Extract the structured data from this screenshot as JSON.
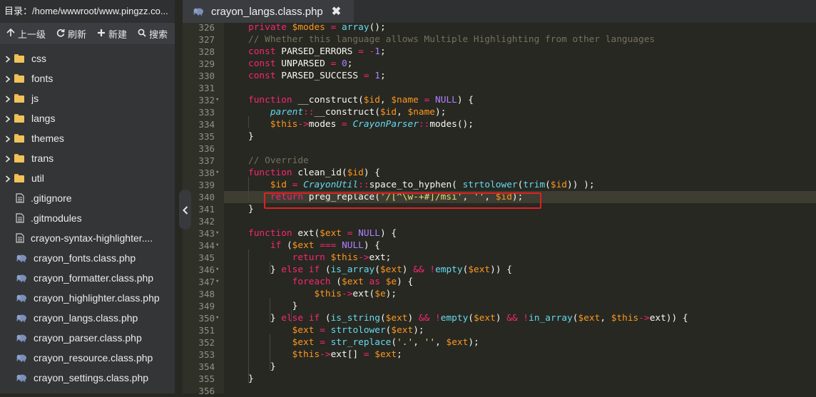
{
  "sidebar": {
    "path_label": "目录：/home/wwwroot/www.pingzz.co...",
    "toolbar": {
      "up": "上一级",
      "refresh": "刷新",
      "new": "新建",
      "search": "搜索"
    },
    "folders": [
      "css",
      "fonts",
      "js",
      "langs",
      "themes",
      "trans",
      "util"
    ],
    "files": [
      {
        "name": ".gitignore",
        "type": "file"
      },
      {
        "name": ".gitmodules",
        "type": "file"
      },
      {
        "name": "crayon-syntax-highlighter....",
        "type": "file"
      },
      {
        "name": "crayon_fonts.class.php",
        "type": "php"
      },
      {
        "name": "crayon_formatter.class.php",
        "type": "php"
      },
      {
        "name": "crayon_highlighter.class.php",
        "type": "php"
      },
      {
        "name": "crayon_langs.class.php",
        "type": "php"
      },
      {
        "name": "crayon_parser.class.php",
        "type": "php"
      },
      {
        "name": "crayon_resource.class.php",
        "type": "php"
      },
      {
        "name": "crayon_settings.class.php",
        "type": "php"
      }
    ]
  },
  "tab": {
    "title": "crayon_langs.class.php",
    "close": "✖"
  },
  "editor": {
    "active_line": 340,
    "highlighted_line": 340,
    "lines": [
      {
        "n": "326",
        "fold": false,
        "t": [
          [
            "k",
            "private "
          ],
          [
            "v",
            "$modes"
          ],
          [
            "p",
            " "
          ],
          [
            "k",
            "="
          ],
          [
            "p",
            " "
          ],
          [
            "d",
            "array"
          ],
          [
            "p",
            "();"
          ]
        ]
      },
      {
        "n": "327",
        "fold": false,
        "t": [
          [
            "c",
            "// Whether this language allows Multiple Highlighting from other languages"
          ]
        ]
      },
      {
        "n": "328",
        "fold": false,
        "t": [
          [
            "k",
            "const "
          ],
          [
            "p",
            "PARSED_ERRORS "
          ],
          [
            "k",
            "="
          ],
          [
            "p",
            " "
          ],
          [
            "k",
            "-"
          ],
          [
            "n",
            "1"
          ],
          [
            "p",
            ";"
          ]
        ]
      },
      {
        "n": "329",
        "fold": false,
        "t": [
          [
            "k",
            "const "
          ],
          [
            "p",
            "UNPARSED "
          ],
          [
            "k",
            "="
          ],
          [
            "p",
            " "
          ],
          [
            "n",
            "0"
          ],
          [
            "p",
            ";"
          ]
        ]
      },
      {
        "n": "330",
        "fold": false,
        "t": [
          [
            "k",
            "const "
          ],
          [
            "p",
            "PARSED_SUCCESS "
          ],
          [
            "k",
            "="
          ],
          [
            "p",
            " "
          ],
          [
            "n",
            "1"
          ],
          [
            "p",
            ";"
          ]
        ]
      },
      {
        "n": "331",
        "fold": false,
        "t": []
      },
      {
        "n": "332",
        "fold": true,
        "t": [
          [
            "k",
            "function "
          ],
          [
            "p",
            "__construct("
          ],
          [
            "v",
            "$id"
          ],
          [
            "p",
            ", "
          ],
          [
            "v",
            "$name"
          ],
          [
            "p",
            " "
          ],
          [
            "k",
            "="
          ],
          [
            "p",
            " "
          ],
          [
            "n",
            "NULL"
          ],
          [
            "p",
            ") {"
          ]
        ]
      },
      {
        "n": "333",
        "fold": false,
        "t": [
          [
            "p",
            "    "
          ],
          [
            "cl",
            "parent"
          ],
          [
            "k",
            "::"
          ],
          [
            "p",
            "__construct("
          ],
          [
            "v",
            "$id"
          ],
          [
            "p",
            ", "
          ],
          [
            "v",
            "$name"
          ],
          [
            "p",
            ");"
          ]
        ]
      },
      {
        "n": "334",
        "fold": false,
        "t": [
          [
            "p",
            "    "
          ],
          [
            "v",
            "$this"
          ],
          [
            "k",
            "->"
          ],
          [
            "p",
            "modes "
          ],
          [
            "k",
            "="
          ],
          [
            "p",
            " "
          ],
          [
            "cl",
            "CrayonParser"
          ],
          [
            "k",
            "::"
          ],
          [
            "p",
            "modes();"
          ]
        ]
      },
      {
        "n": "335",
        "fold": false,
        "t": [
          [
            "p",
            "}"
          ]
        ]
      },
      {
        "n": "336",
        "fold": false,
        "t": []
      },
      {
        "n": "337",
        "fold": false,
        "t": [
          [
            "c",
            "// Override"
          ]
        ]
      },
      {
        "n": "338",
        "fold": true,
        "t": [
          [
            "k",
            "function "
          ],
          [
            "p",
            "clean_id("
          ],
          [
            "v",
            "$id"
          ],
          [
            "p",
            ") {"
          ]
        ]
      },
      {
        "n": "339",
        "fold": false,
        "t": [
          [
            "p",
            "    "
          ],
          [
            "v",
            "$id"
          ],
          [
            "p",
            " "
          ],
          [
            "k",
            "="
          ],
          [
            "p",
            " "
          ],
          [
            "cl",
            "CrayonUtil"
          ],
          [
            "k",
            "::"
          ],
          [
            "p",
            "space_to_hyphen( "
          ],
          [
            "d",
            "strtolower"
          ],
          [
            "p",
            "("
          ],
          [
            "d",
            "trim"
          ],
          [
            "p",
            "("
          ],
          [
            "v",
            "$id"
          ],
          [
            "p",
            ")) );"
          ]
        ]
      },
      {
        "n": "340",
        "fold": false,
        "t": [
          [
            "p",
            "    "
          ],
          [
            "k",
            "return "
          ],
          [
            "p",
            "preg_replace("
          ],
          [
            "s",
            "'/[^\\w-+#]/msi'"
          ],
          [
            "p",
            ", "
          ],
          [
            "s",
            "''"
          ],
          [
            "p",
            ", "
          ],
          [
            "v",
            "$id"
          ],
          [
            "p",
            ");"
          ]
        ]
      },
      {
        "n": "341",
        "fold": false,
        "t": [
          [
            "p",
            "}"
          ]
        ]
      },
      {
        "n": "342",
        "fold": false,
        "t": []
      },
      {
        "n": "343",
        "fold": true,
        "t": [
          [
            "k",
            "function "
          ],
          [
            "p",
            "ext("
          ],
          [
            "v",
            "$ext"
          ],
          [
            "p",
            " "
          ],
          [
            "k",
            "="
          ],
          [
            "p",
            " "
          ],
          [
            "n",
            "NULL"
          ],
          [
            "p",
            ") {"
          ]
        ]
      },
      {
        "n": "344",
        "fold": true,
        "t": [
          [
            "p",
            "    "
          ],
          [
            "k",
            "if "
          ],
          [
            "p",
            "("
          ],
          [
            "v",
            "$ext"
          ],
          [
            "p",
            " "
          ],
          [
            "k",
            "==="
          ],
          [
            "p",
            " "
          ],
          [
            "n",
            "NULL"
          ],
          [
            "p",
            ") {"
          ]
        ]
      },
      {
        "n": "345",
        "fold": false,
        "t": [
          [
            "p",
            "        "
          ],
          [
            "k",
            "return "
          ],
          [
            "v",
            "$this"
          ],
          [
            "k",
            "->"
          ],
          [
            "p",
            "ext;"
          ]
        ]
      },
      {
        "n": "346",
        "fold": true,
        "t": [
          [
            "p",
            "    } "
          ],
          [
            "k",
            "else if "
          ],
          [
            "p",
            "("
          ],
          [
            "d",
            "is_array"
          ],
          [
            "p",
            "("
          ],
          [
            "v",
            "$ext"
          ],
          [
            "p",
            ") "
          ],
          [
            "k",
            "&&"
          ],
          [
            "p",
            " "
          ],
          [
            "k",
            "!"
          ],
          [
            "d",
            "empty"
          ],
          [
            "p",
            "("
          ],
          [
            "v",
            "$ext"
          ],
          [
            "p",
            ")) {"
          ]
        ]
      },
      {
        "n": "347",
        "fold": true,
        "t": [
          [
            "p",
            "        "
          ],
          [
            "k",
            "foreach "
          ],
          [
            "p",
            "("
          ],
          [
            "v",
            "$ext"
          ],
          [
            "p",
            " "
          ],
          [
            "k",
            "as"
          ],
          [
            "p",
            " "
          ],
          [
            "v",
            "$e"
          ],
          [
            "p",
            ") {"
          ]
        ]
      },
      {
        "n": "348",
        "fold": false,
        "t": [
          [
            "p",
            "            "
          ],
          [
            "v",
            "$this"
          ],
          [
            "k",
            "->"
          ],
          [
            "p",
            "ext("
          ],
          [
            "v",
            "$e"
          ],
          [
            "p",
            ");"
          ]
        ]
      },
      {
        "n": "349",
        "fold": false,
        "t": [
          [
            "p",
            "        }"
          ]
        ]
      },
      {
        "n": "350",
        "fold": true,
        "t": [
          [
            "p",
            "    } "
          ],
          [
            "k",
            "else if "
          ],
          [
            "p",
            "("
          ],
          [
            "d",
            "is_string"
          ],
          [
            "p",
            "("
          ],
          [
            "v",
            "$ext"
          ],
          [
            "p",
            ") "
          ],
          [
            "k",
            "&&"
          ],
          [
            "p",
            " "
          ],
          [
            "k",
            "!"
          ],
          [
            "d",
            "empty"
          ],
          [
            "p",
            "("
          ],
          [
            "v",
            "$ext"
          ],
          [
            "p",
            ") "
          ],
          [
            "k",
            "&&"
          ],
          [
            "p",
            " "
          ],
          [
            "k",
            "!"
          ],
          [
            "d",
            "in_array"
          ],
          [
            "p",
            "("
          ],
          [
            "v",
            "$ext"
          ],
          [
            "p",
            ", "
          ],
          [
            "v",
            "$this"
          ],
          [
            "k",
            "->"
          ],
          [
            "p",
            "ext)) {"
          ]
        ]
      },
      {
        "n": "351",
        "fold": false,
        "t": [
          [
            "p",
            "        "
          ],
          [
            "v",
            "$ext"
          ],
          [
            "p",
            " "
          ],
          [
            "k",
            "="
          ],
          [
            "p",
            " "
          ],
          [
            "d",
            "strtolower"
          ],
          [
            "p",
            "("
          ],
          [
            "v",
            "$ext"
          ],
          [
            "p",
            ");"
          ]
        ]
      },
      {
        "n": "352",
        "fold": false,
        "t": [
          [
            "p",
            "        "
          ],
          [
            "v",
            "$ext"
          ],
          [
            "p",
            " "
          ],
          [
            "k",
            "="
          ],
          [
            "p",
            " "
          ],
          [
            "d",
            "str_replace"
          ],
          [
            "p",
            "("
          ],
          [
            "s",
            "'.'"
          ],
          [
            "p",
            ", "
          ],
          [
            "s",
            "''"
          ],
          [
            "p",
            ", "
          ],
          [
            "v",
            "$ext"
          ],
          [
            "p",
            ");"
          ]
        ]
      },
      {
        "n": "353",
        "fold": false,
        "t": [
          [
            "p",
            "        "
          ],
          [
            "v",
            "$this"
          ],
          [
            "k",
            "->"
          ],
          [
            "p",
            "ext[] "
          ],
          [
            "k",
            "="
          ],
          [
            "p",
            " "
          ],
          [
            "v",
            "$ext"
          ],
          [
            "p",
            ";"
          ]
        ]
      },
      {
        "n": "354",
        "fold": false,
        "t": [
          [
            "p",
            "    }"
          ]
        ]
      },
      {
        "n": "355",
        "fold": false,
        "t": [
          [
            "p",
            "}"
          ]
        ]
      },
      {
        "n": "356",
        "fold": false,
        "t": []
      }
    ]
  },
  "colors": {
    "background": "#272822",
    "keyword": "#f92672",
    "builtin": "#66d9ef",
    "variable": "#fd971f",
    "comment": "#75715e",
    "string": "#e6db74",
    "number": "#ae81ff",
    "highlight_box": "#e02020",
    "folder": "#f0c25a"
  },
  "icons": {
    "up": "arrow-up-icon",
    "refresh": "refresh-icon",
    "new": "plus-icon",
    "search": "search-icon",
    "folder": "folder-icon",
    "file": "file-icon",
    "php": "php-elephant-icon",
    "collapse": "chevron-left-icon"
  }
}
